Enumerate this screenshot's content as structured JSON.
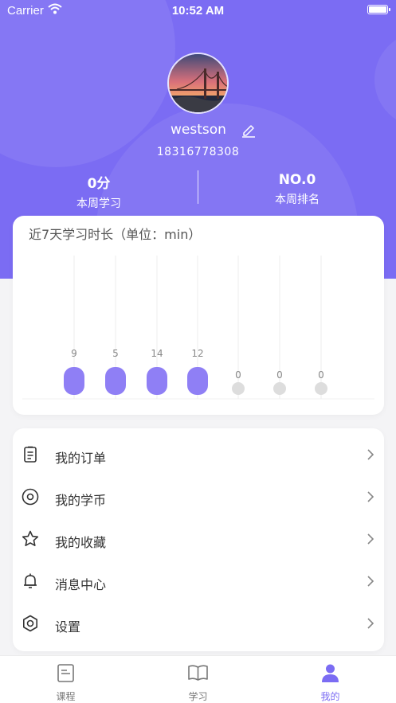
{
  "status_bar": {
    "carrier": "Carrier",
    "time": "10:52 AM"
  },
  "profile": {
    "username": "westson",
    "phone": "18316778308"
  },
  "stats": [
    {
      "value": "0分",
      "label": "本周学习"
    },
    {
      "value": "NO.0",
      "label": "本周排名"
    }
  ],
  "chart_data": {
    "type": "bar",
    "title": "近7天学习时长（单位：min）",
    "values": [
      9,
      5,
      14,
      12,
      0,
      0,
      0
    ],
    "colors": {
      "active": "#8f7ff5",
      "zero": "#dddddd"
    }
  },
  "menu": [
    {
      "label": "我的订单",
      "icon": "clipboard-icon"
    },
    {
      "label": "我的学币",
      "icon": "coin-icon"
    },
    {
      "label": "我的收藏",
      "icon": "star-icon"
    },
    {
      "label": "消息中心",
      "icon": "bell-icon"
    },
    {
      "label": "设置",
      "icon": "gear-icon"
    }
  ],
  "tabs": [
    {
      "label": "课程",
      "icon": "course-icon",
      "active": false
    },
    {
      "label": "学习",
      "icon": "book-icon",
      "active": false
    },
    {
      "label": "我的",
      "icon": "user-icon",
      "active": true
    }
  ],
  "colors": {
    "accent": "#7b6cf3"
  }
}
